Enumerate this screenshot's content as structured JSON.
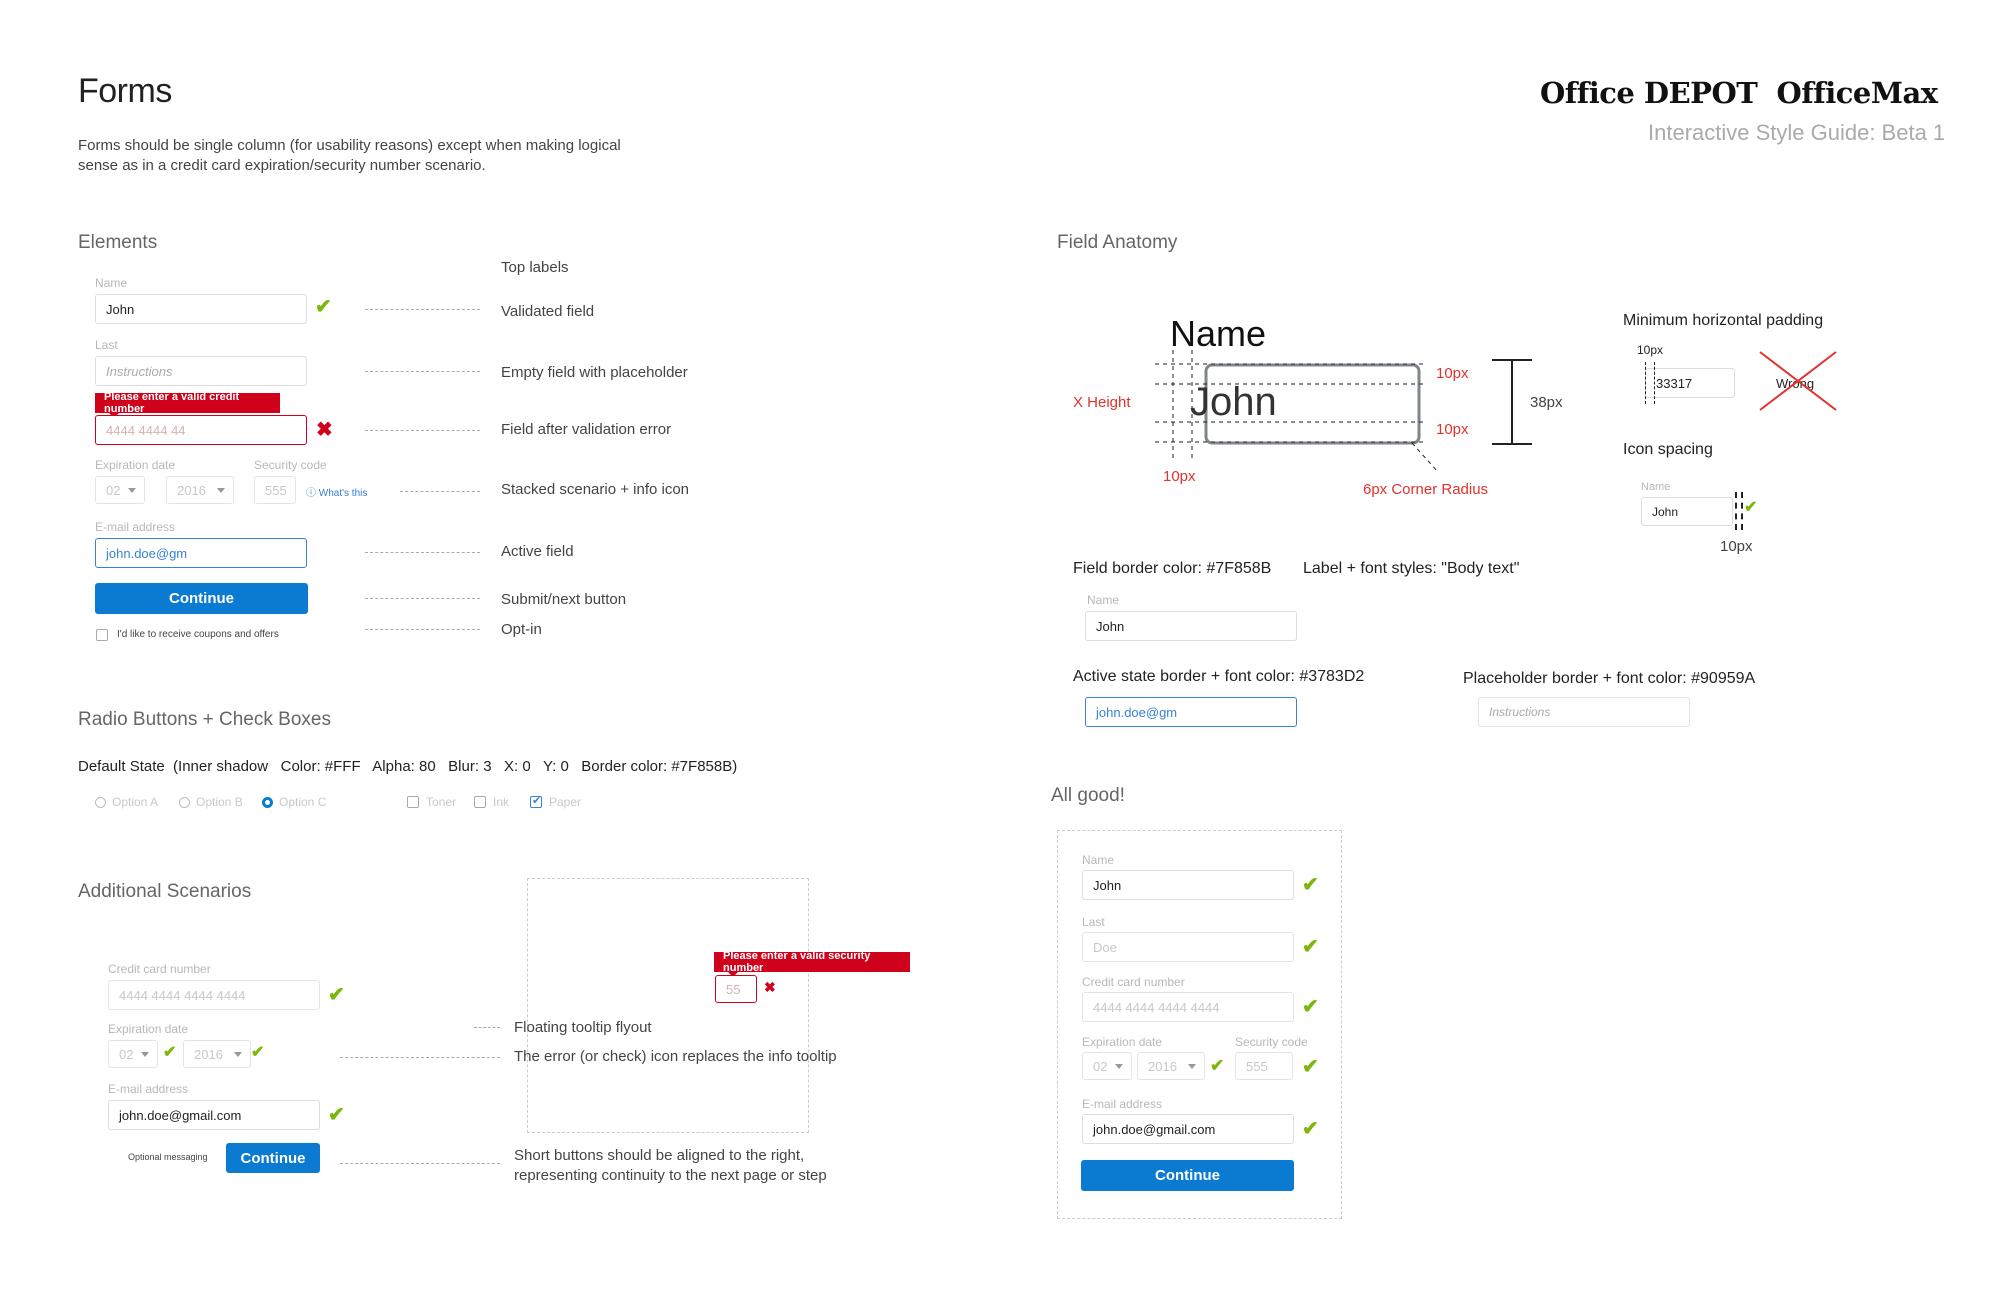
{
  "header": {
    "title": "Forms",
    "intro_line1": "Forms should be single column (for usability reasons) except when making logical",
    "intro_line2": "sense as in a credit card expiration/security number scenario.",
    "brand_depot": "Office DEPOT",
    "brand_max": "OfficeMax",
    "subtitle": "Interactive Style Guide: Beta 1"
  },
  "elements": {
    "section_title": "Elements",
    "name_label": "Name",
    "name_value": "John",
    "last_label": "Last",
    "last_placeholder": "Instructions",
    "error_tooltip": "Please enter a valid credit number",
    "card_placeholder": "4444 4444 44",
    "exp_label": "Expiration date",
    "sec_label": "Security code",
    "exp_month": "02",
    "exp_year": "2016",
    "sec_value": "555",
    "whats_this": "What's this",
    "email_label": "E-mail address",
    "email_value": "john.doe@gm",
    "continue": "Continue",
    "optin": "I'd like to receive coupons and offers",
    "notes": {
      "top_labels": "Top labels",
      "validated": "Validated field",
      "empty": "Empty field with placeholder",
      "error": "Field after validation error",
      "stacked": "Stacked scenario + info icon",
      "active": "Active field",
      "submit": "Submit/next button",
      "optin": "Opt-in"
    }
  },
  "radios": {
    "section_title": "Radio Buttons + Check Boxes",
    "default_state": "Default State  (Inner shadow   Color: #FFF   Alpha: 80   Blur: 3   X: 0   Y: 0   Border color: #7F858B)",
    "options": [
      "Option A",
      "Option B",
      "Option C"
    ],
    "checks": [
      "Toner",
      "Ink",
      "Paper"
    ]
  },
  "additional": {
    "section_title": "Additional Scenarios",
    "cc_label": "Credit card number",
    "cc_placeholder": "4444 4444 4444 4444",
    "exp_label": "Expiration date",
    "exp_month": "02",
    "exp_year": "2016",
    "email_label": "E-mail address",
    "email_value": "john.doe@gmail.com",
    "optional": "Optional messaging",
    "continue": "Continue",
    "sec_tooltip": "Please enter a valid security number",
    "sec_value": "55",
    "notes": {
      "floating": "Floating tooltip flyout",
      "icon_replace": "The error (or check) icon replaces the info tooltip",
      "short1": "Short buttons should be aligned to the right,",
      "short2": "representing continuity to the next page or step"
    }
  },
  "anatomy": {
    "section_title": "Field Anatomy",
    "name": "Name",
    "john": "John",
    "x_height": "X Height",
    "px10": "10px",
    "px38": "38px",
    "radius": "6px Corner Radius",
    "min_padding": "Minimum horizontal padding",
    "pad_value": "33317",
    "wrong": "Wrong",
    "icon_spacing": "Icon spacing",
    "icon_label": "Name",
    "icon_value": "John",
    "border_color": "Field border color: #7F858B",
    "label_font": "Label + font styles: \"Body text\"",
    "demo_label": "Name",
    "demo_value": "John",
    "active_color": "Active state border + font color: #3783D2",
    "active_value": "john.doe@gm",
    "placeholder_color": "Placeholder border + font color: #90959A",
    "placeholder_value": "Instructions"
  },
  "allgood": {
    "section_title": "All good!",
    "name_label": "Name",
    "name_value": "John",
    "last_label": "Last",
    "last_placeholder": "Doe",
    "cc_label": "Credit card number",
    "cc_placeholder": "4444 4444 4444 4444",
    "exp_label": "Expiration date",
    "sec_label": "Security code",
    "exp_month": "02",
    "exp_year": "2016",
    "sec_value": "555",
    "email_label": "E-mail address",
    "email_value": "john.doe@gmail.com",
    "continue": "Continue"
  },
  "colors": {
    "accent": "#0b7ad1",
    "error": "#d0021b",
    "valid": "#7cb70c",
    "active": "#3783D2",
    "border": "#7F858B",
    "placeholder": "#90959A"
  }
}
